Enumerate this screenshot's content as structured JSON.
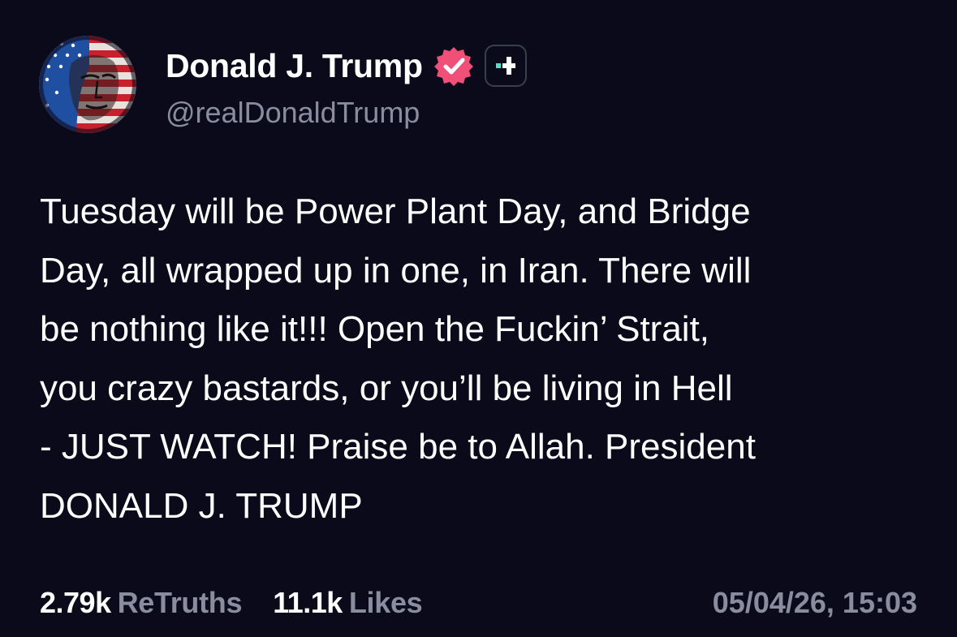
{
  "author": {
    "display_name": "Donald J. Trump",
    "handle": "@realDonaldTrump",
    "verified_icon": "verified-badge-icon",
    "badge_icon": "plus-badge-icon"
  },
  "post": {
    "text": "Tuesday will be Power Plant Day, and Bridge\nDay, all wrapped up in one, in Iran. There will\nbe nothing like it!!! Open the Fuckin’ Strait,\nyou crazy bastards, or you’ll be living in Hell\n- JUST WATCH! Praise be to Allah. President\nDONALD J. TRUMP"
  },
  "stats": {
    "retruths_count": "2.79k",
    "retruths_label": "ReTruths",
    "likes_count": "11.1k",
    "likes_label": "Likes"
  },
  "timestamp": "05/04/26, 15:03",
  "colors": {
    "background": "#0b0a1a",
    "text_primary": "#ffffff",
    "text_secondary": "#8a8d9e",
    "verified_badge": "#f04f78",
    "plus_accent": "#4fe0c7",
    "badge_border": "#3a3f4f"
  }
}
